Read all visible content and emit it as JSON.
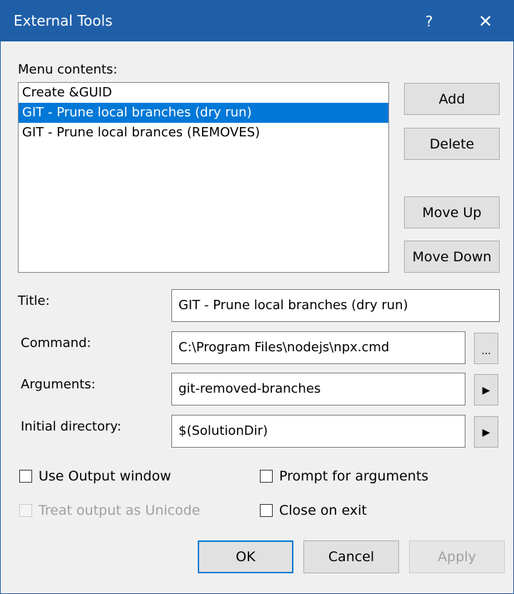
{
  "window": {
    "title": "External Tools",
    "help_label": "?",
    "close_label": "✕"
  },
  "menu_contents": {
    "label": "Menu contents:",
    "items": [
      {
        "label": "Create &GUID",
        "selected": false
      },
      {
        "label": "GIT - Prune local branches (dry run)",
        "selected": true
      },
      {
        "label": "GIT - Prune local brances (REMOVES)",
        "selected": false
      }
    ]
  },
  "side_buttons": {
    "add": "Add",
    "delete": "Delete",
    "move_up": "Move Up",
    "move_down": "Move Down"
  },
  "fields": {
    "title": {
      "label": "Title:",
      "value": "GIT - Prune local branches (dry run)"
    },
    "command": {
      "label": "Command:",
      "value": "C:\\Program Files\\nodejs\\npx.cmd",
      "browse_label": "..."
    },
    "arguments": {
      "label": "Arguments:",
      "value": "git-removed-branches",
      "menu_label": "▶"
    },
    "initial_directory": {
      "label": "Initial directory:",
      "value": "$(SolutionDir)",
      "menu_label": "▶"
    }
  },
  "options": {
    "use_output_window": {
      "label": "Use Output window",
      "checked": false
    },
    "prompt_for_arguments": {
      "label": "Prompt for arguments",
      "checked": false
    },
    "treat_output_as_unicode": {
      "label": "Treat output as Unicode",
      "checked": false,
      "disabled": true
    },
    "close_on_exit": {
      "label": "Close on exit",
      "checked": false
    }
  },
  "footer": {
    "ok": "OK",
    "cancel": "Cancel",
    "apply": "Apply"
  },
  "colors": {
    "titlebar": "#1f5fa8",
    "selection": "#0078d7",
    "dialog_bg": "#f0f0f0"
  }
}
